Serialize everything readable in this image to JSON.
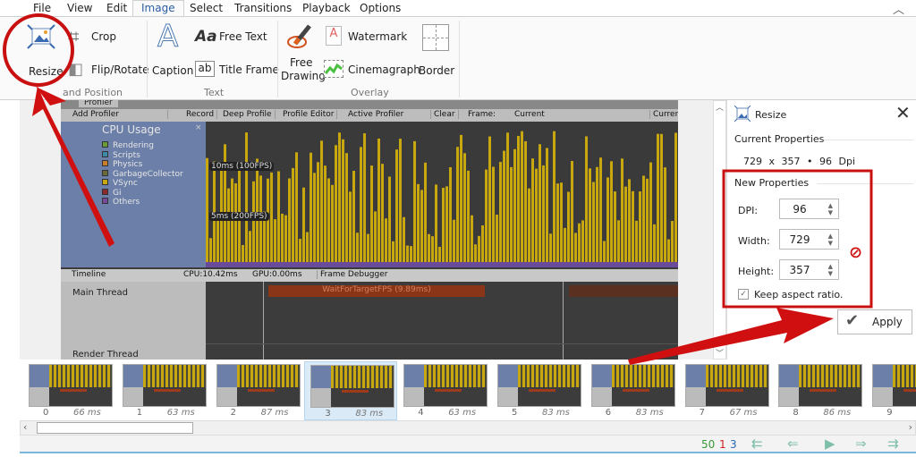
{
  "menu": {
    "tabs": [
      "File",
      "View",
      "Edit",
      "Image",
      "Select",
      "Transitions",
      "Playback",
      "Options"
    ],
    "active": "Image"
  },
  "ribbon": {
    "size_group": {
      "label": "and Position",
      "resize": "Resize",
      "crop": "Crop",
      "flip": "Flip/Rotate"
    },
    "text_group": {
      "label": "Text",
      "caption": "Caption",
      "free_text": "Free Text",
      "title_frame": "Title Frame",
      "aa": "Aa",
      "ab": "ab"
    },
    "overlay_group": {
      "label": "Overlay",
      "free_drawing_1": "Free",
      "free_drawing_2": "Drawing",
      "watermark": "Watermark",
      "cinemagraph": "Cinemagraph",
      "border": "Border"
    }
  },
  "profiler": {
    "tab": "Profiler",
    "toolbar": [
      "Add Profiler",
      "Record",
      "Deep Profile",
      "Profile Editor",
      "Active Profiler",
      "Clear",
      "Frame:",
      "Current",
      "Curren"
    ],
    "legend_title": "CPU Usage",
    "legend": [
      {
        "name": "Rendering",
        "color": "#6a9a3a"
      },
      {
        "name": "Scripts",
        "color": "#3a8aa8"
      },
      {
        "name": "Physics",
        "color": "#c8802a"
      },
      {
        "name": "GarbageCollector",
        "color": "#6a6a3a"
      },
      {
        "name": "VSync",
        "color": "#c9a80f"
      },
      {
        "name": "Gi",
        "color": "#8a2a2a"
      },
      {
        "name": "Others",
        "color": "#7a4a9a"
      }
    ],
    "line_10": "10ms (100FPS)",
    "line_5": "5ms (200FPS)",
    "timeline": "Timeline",
    "cpu": "CPU:10.42ms",
    "gpu": "GPU:0.00ms",
    "frame_debugger": "Frame Debugger",
    "main_thread": "Main Thread",
    "render_thread": "Render Thread",
    "wait": "WaitForTargetFPS (9.89ms)"
  },
  "resize_panel": {
    "title": "Resize",
    "current_label": "Current Properties",
    "current": {
      "width": "729",
      "x": "x",
      "height": "357",
      "dot": "•",
      "dpi": "96",
      "dpi_unit": "Dpi"
    },
    "new_label": "New Properties",
    "dpi_label": "DPI:",
    "dpi": "96",
    "width_label": "Width:",
    "width": "729",
    "height_label": "Height:",
    "height": "357",
    "keep_aspect": "Keep aspect ratio.",
    "keep_aspect_checked": true,
    "apply": "Apply"
  },
  "frames": [
    {
      "n": "0",
      "d": "66 ms"
    },
    {
      "n": "1",
      "d": "63 ms"
    },
    {
      "n": "2",
      "d": "87 ms"
    },
    {
      "n": "3",
      "d": "83 ms",
      "selected": true
    },
    {
      "n": "4",
      "d": "63 ms"
    },
    {
      "n": "5",
      "d": "83 ms"
    },
    {
      "n": "6",
      "d": "83 ms"
    },
    {
      "n": "7",
      "d": "67 ms"
    },
    {
      "n": "8",
      "d": "86 ms"
    },
    {
      "n": "9",
      "d": ""
    }
  ],
  "status": {
    "total": "50",
    "selected": "1",
    "current": "3"
  },
  "colors": {
    "accent": "#2a5ea8",
    "annotation_red": "#d01010"
  }
}
